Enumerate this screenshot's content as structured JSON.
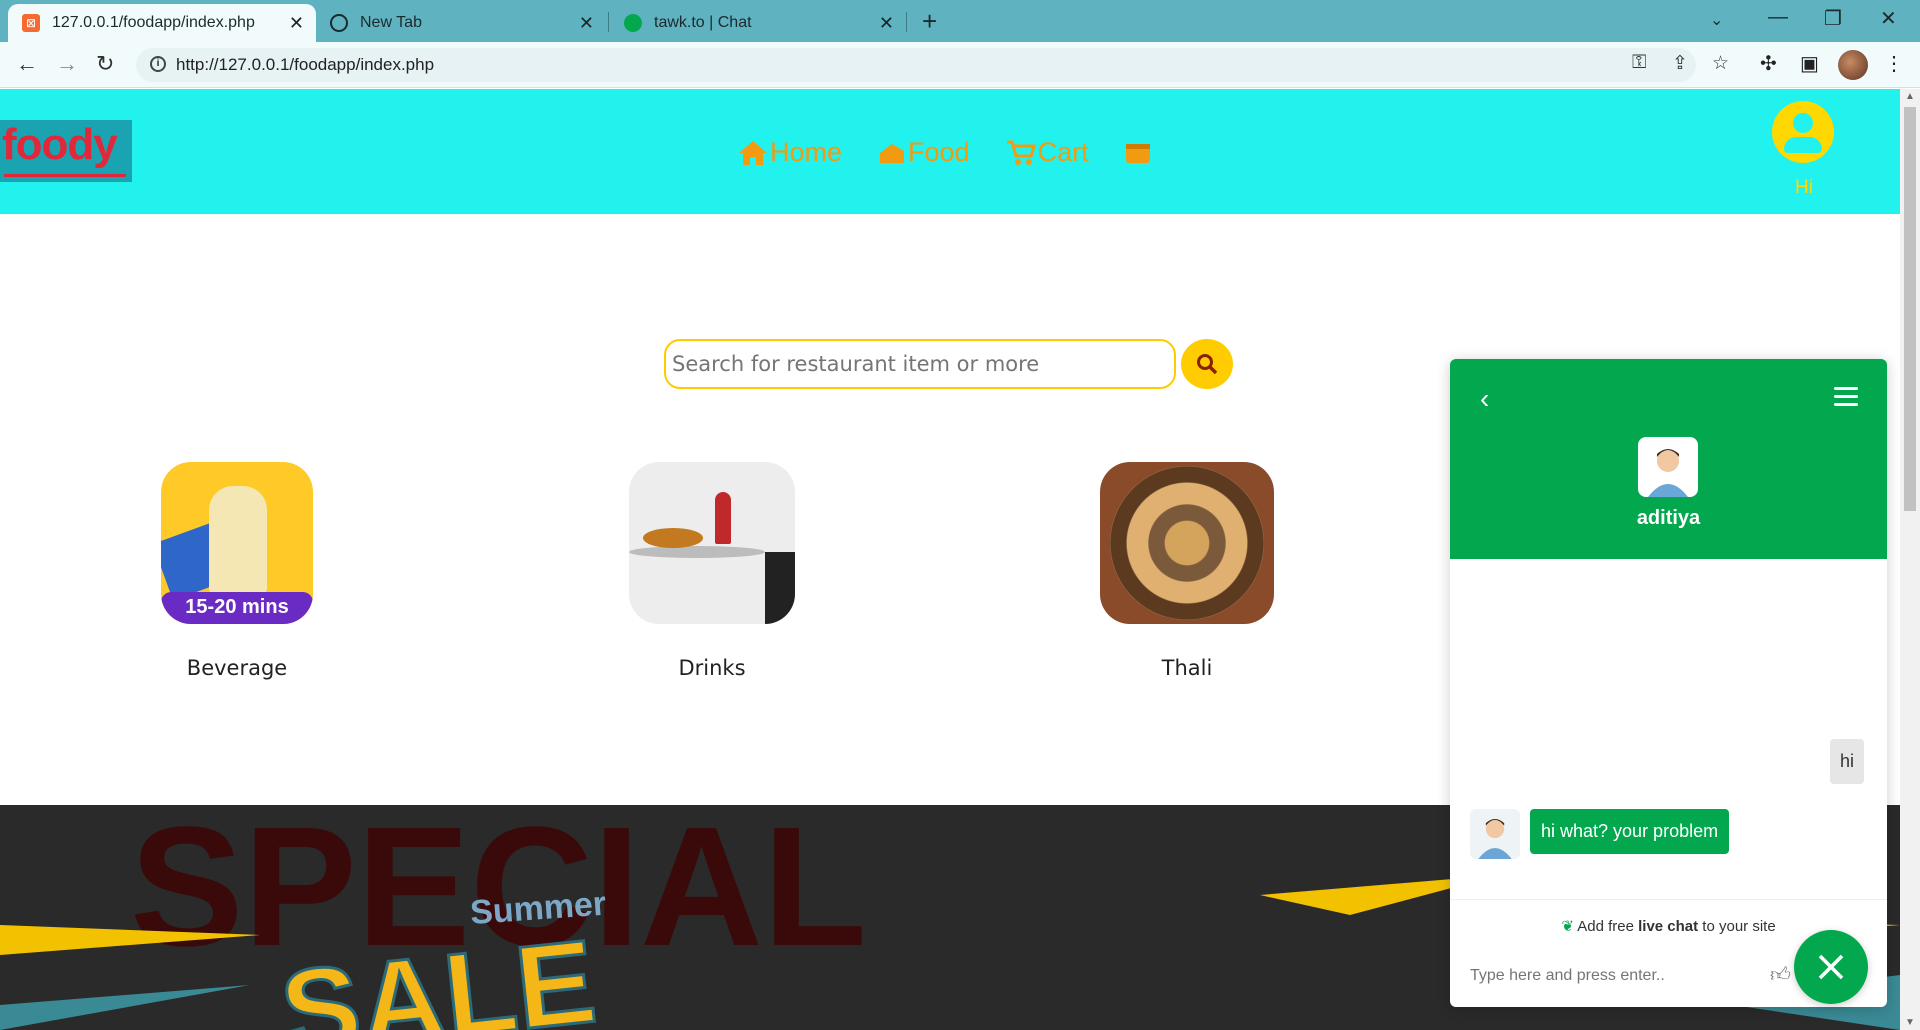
{
  "browser": {
    "tabs": [
      {
        "title": "127.0.0.1/foodapp/index.php",
        "active": true
      },
      {
        "title": "New Tab",
        "active": false
      },
      {
        "title": "tawk.to | Chat",
        "active": false
      }
    ],
    "url": "http://127.0.0.1/foodapp/index.php"
  },
  "site": {
    "logo": "foody",
    "nav": [
      {
        "label": "Home",
        "icon": "home-icon"
      },
      {
        "label": "Food",
        "icon": "food-icon"
      },
      {
        "label": "Cart",
        "icon": "cart-icon"
      },
      {
        "label": "",
        "icon": "wallet-icon"
      }
    ],
    "user_greeting": "Hi",
    "search": {
      "placeholder": "Search for restaurant item or more"
    },
    "categories": [
      {
        "label": "Beverage",
        "badge": "15-20 mins"
      },
      {
        "label": "Drinks"
      },
      {
        "label": "Thali"
      }
    ],
    "banner": {
      "line1": "Summer",
      "line2": "SALE",
      "back_text": "SPECIAL"
    }
  },
  "chat": {
    "agent_name": "aditiya",
    "messages": [
      {
        "from": "visitor",
        "text": "hi"
      },
      {
        "from": "agent",
        "text": "hi what? your problem"
      }
    ],
    "powered_prefix": "Add free ",
    "powered_bold": "live chat",
    "powered_suffix": " to your site",
    "input_placeholder": "Type here and press enter.."
  },
  "colors": {
    "header_bg": "#21f2ee",
    "accent_orange": "#f29a10",
    "accent_yellow": "#ffcc00",
    "chat_green": "#03a84e"
  }
}
